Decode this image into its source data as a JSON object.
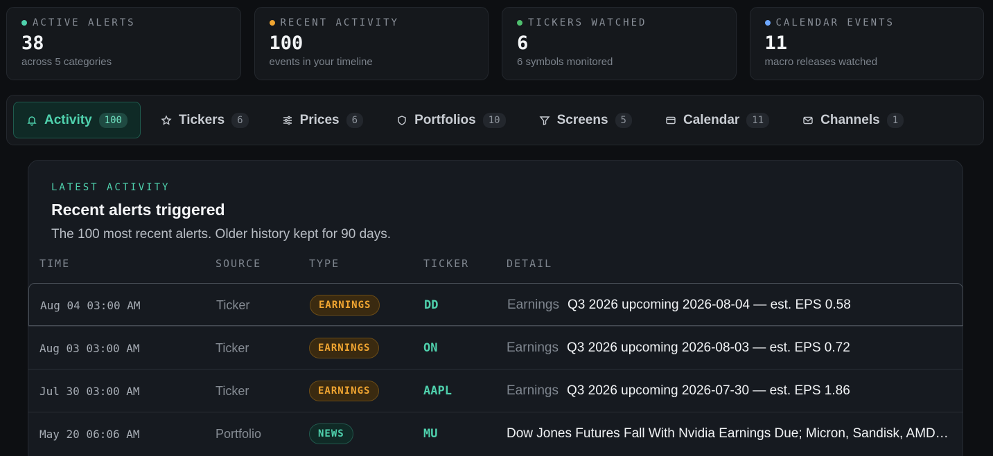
{
  "stats": [
    {
      "label": "ACTIVE ALERTS",
      "value": "38",
      "sub": "across 5 categories",
      "color": "#4fd1ad"
    },
    {
      "label": "RECENT ACTIVITY",
      "value": "100",
      "sub": "events in your timeline",
      "color": "#f0a531"
    },
    {
      "label": "TICKERS WATCHED",
      "value": "6",
      "sub": "6 symbols monitored",
      "color": "#4fbf6e"
    },
    {
      "label": "CALENDAR EVENTS",
      "value": "11",
      "sub": "macro releases watched",
      "color": "#6ea8ff"
    }
  ],
  "tabs": [
    {
      "label": "Activity",
      "count": "100",
      "icon": "bell-icon"
    },
    {
      "label": "Tickers",
      "count": "6",
      "icon": "star-icon"
    },
    {
      "label": "Prices",
      "count": "6",
      "icon": "sliders-icon"
    },
    {
      "label": "Portfolios",
      "count": "10",
      "icon": "shield-icon"
    },
    {
      "label": "Screens",
      "count": "5",
      "icon": "filter-icon"
    },
    {
      "label": "Calendar",
      "count": "11",
      "icon": "card-icon"
    },
    {
      "label": "Channels",
      "count": "1",
      "icon": "mail-icon"
    }
  ],
  "panel": {
    "eyebrow": "LATEST ACTIVITY",
    "title": "Recent alerts triggered",
    "description": "The 100 most recent alerts. Older history kept for 90 days."
  },
  "table": {
    "headers": [
      "TIME",
      "SOURCE",
      "TYPE",
      "TICKER",
      "DETAIL"
    ],
    "rows": [
      {
        "time": "Aug 04 03:00 AM",
        "source": "Ticker",
        "type": "EARNINGS",
        "ticker": "DD",
        "category": "Earnings",
        "detail": "Q3 2026 upcoming 2026-08-04 — est. EPS 0.58"
      },
      {
        "time": "Aug 03 03:00 AM",
        "source": "Ticker",
        "type": "EARNINGS",
        "ticker": "ON",
        "category": "Earnings",
        "detail": "Q3 2026 upcoming 2026-08-03 — est. EPS 0.72"
      },
      {
        "time": "Jul 30 03:00 AM",
        "source": "Ticker",
        "type": "EARNINGS",
        "ticker": "AAPL",
        "category": "Earnings",
        "detail": "Q3 2026 upcoming 2026-07-30 — est. EPS 1.86"
      },
      {
        "time": "May 20 06:06 AM",
        "source": "Portfolio",
        "type": "NEWS",
        "ticker": "MU",
        "category": "",
        "detail": "Dow Jones Futures Fall With Nvidia Earnings Due; Micron, Sandisk, AMD In Focus"
      }
    ]
  }
}
